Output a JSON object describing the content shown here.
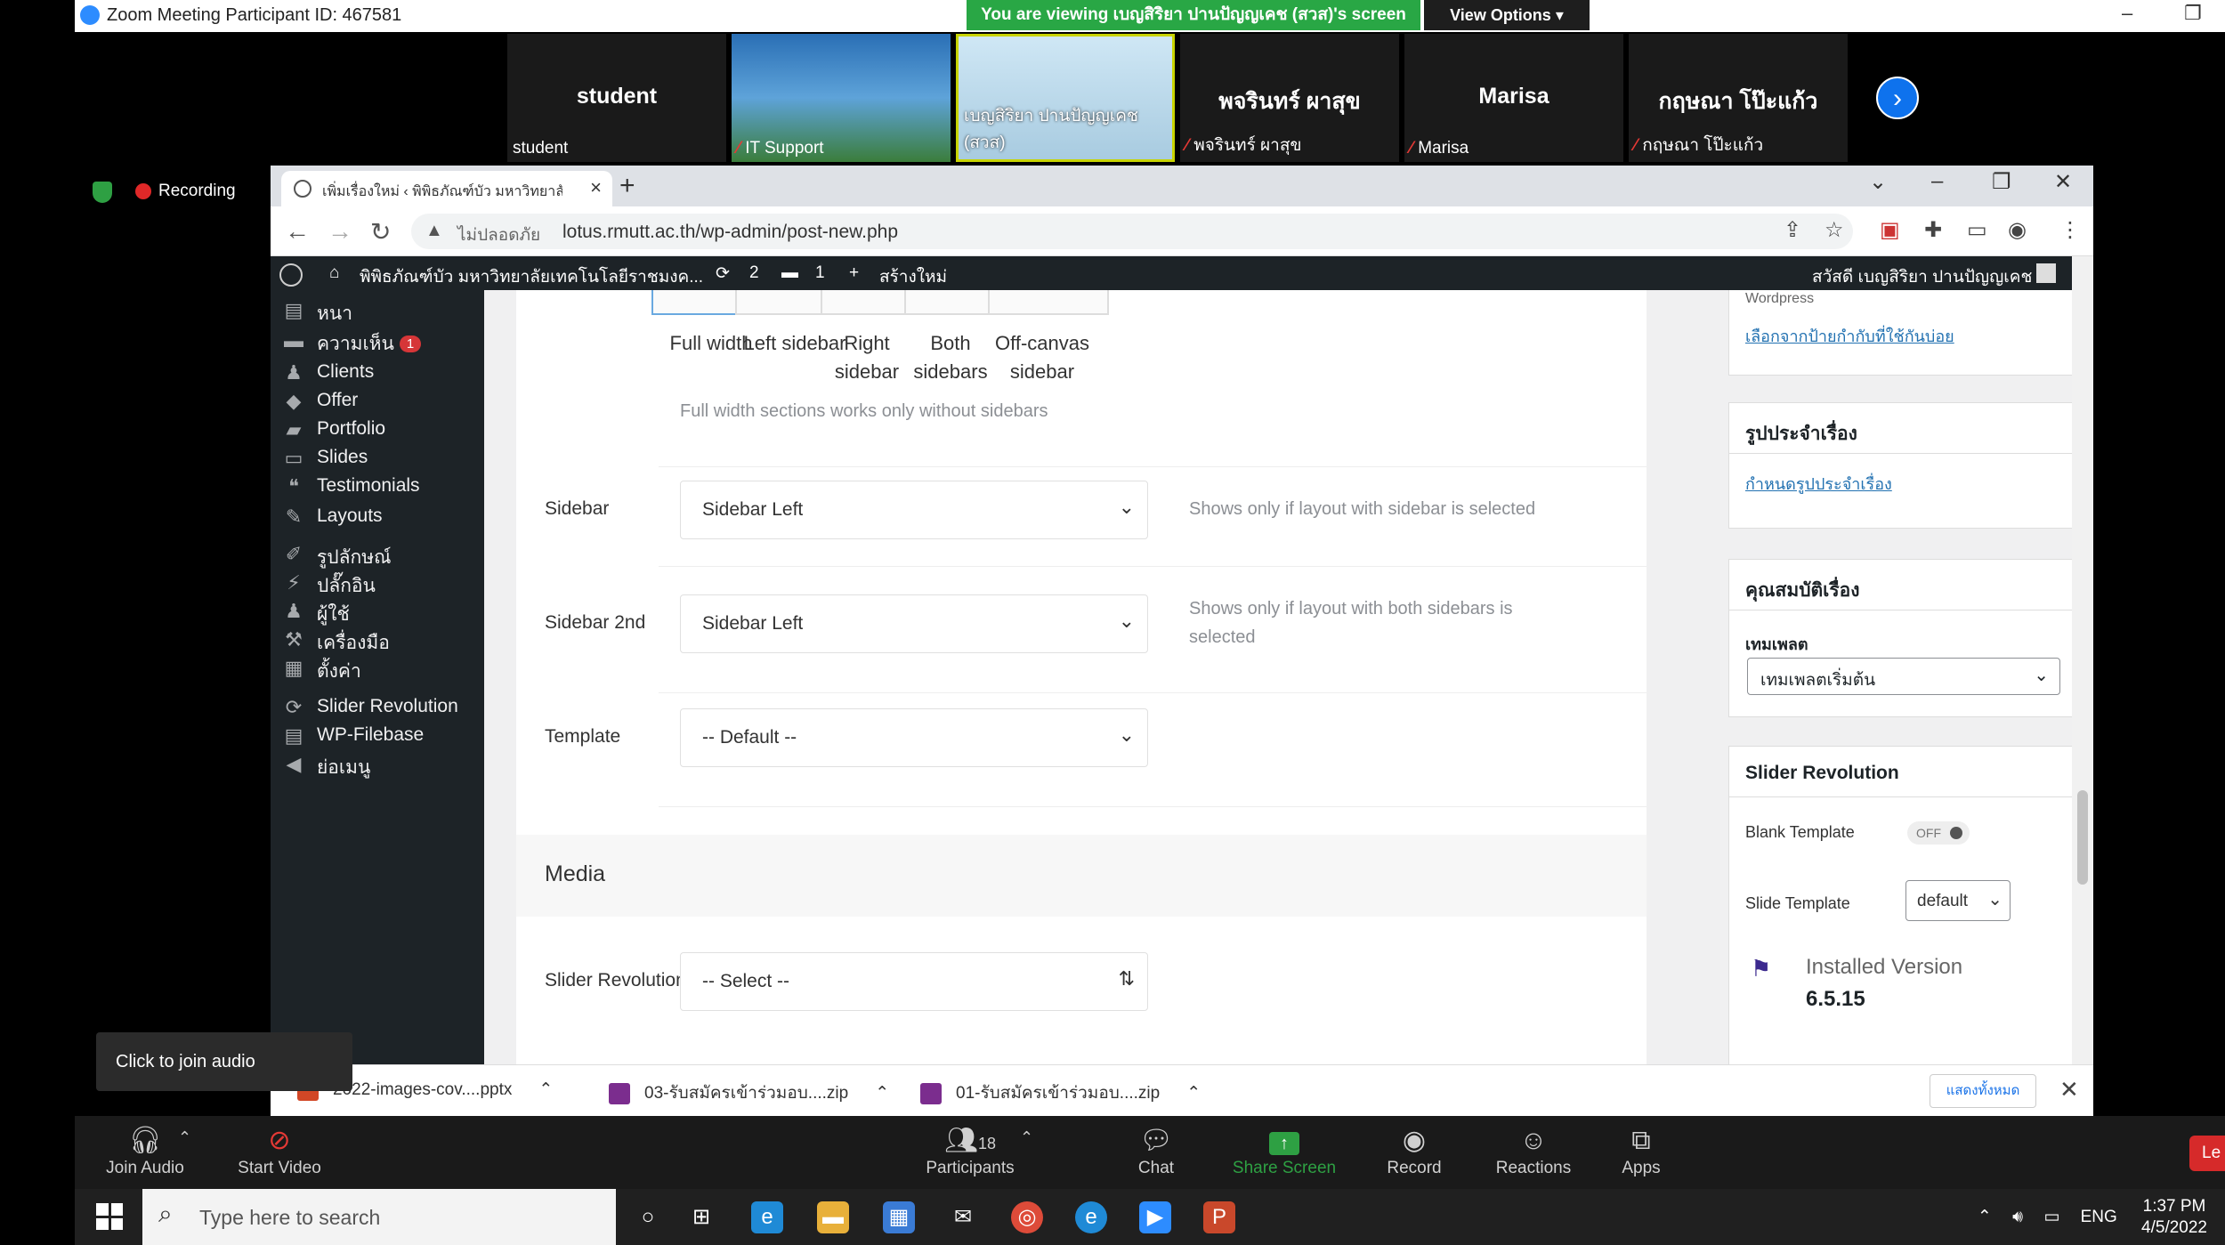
{
  "zoom": {
    "window_title": "Zoom Meeting Participant ID: 467581",
    "banner": "You are viewing เบญสิริยา ปานปัญญเคช (สวส)'s screen",
    "view_options": "View Options",
    "recording": "Recording",
    "join_audio_tooltip": "Click to join audio",
    "participants": [
      {
        "big_name": "student",
        "name": "student",
        "muted": false
      },
      {
        "big_name": "",
        "name": "IT Support",
        "muted": true
      },
      {
        "big_name": "",
        "name": "เบญสิริยา ปานปัญญเคช (สวส)",
        "muted": false
      },
      {
        "big_name": "พจรินทร์ ผาสุข",
        "name": "พจรินทร์ ผาสุข",
        "muted": true
      },
      {
        "big_name": "Marisa",
        "name": "Marisa",
        "muted": true
      },
      {
        "big_name": "กฤษณา โป๊ะแก้ว",
        "name": "กฤษณา โป๊ะแก้ว",
        "muted": true
      }
    ],
    "toolbar": {
      "join_audio": "Join Audio",
      "start_video": "Start Video",
      "participants": "Participants",
      "participants_count": "18",
      "chat": "Chat",
      "share_screen": "Share Screen",
      "record": "Record",
      "reactions": "Reactions",
      "apps": "Apps",
      "leave": "Le"
    }
  },
  "browser": {
    "tab_title": "เพิ่มเรื่องใหม่ ‹ พิพิธภัณฑ์บัว มหาวิทยาลัย",
    "security_label": "ไม่ปลอดภัย",
    "url": "lotus.rmutt.ac.th/wp-admin/post-new.php"
  },
  "wp": {
    "site_name": "พิพิธภัณฑ์บัว มหาวิทยาลัยเทคโนโลยีราชมงค...",
    "updates_count": "2",
    "comments_count": "1",
    "new_label": "สร้างใหม่",
    "greeting": "สวัสดี เบญสิริยา ปานปัญญเคช",
    "menu": [
      {
        "label": "หนา",
        "icon": "page-icon"
      },
      {
        "label": "ความเห็น",
        "icon": "comment-icon",
        "badge": "1"
      },
      {
        "label": "Clients",
        "icon": "clients-icon"
      },
      {
        "label": "Offer",
        "icon": "tag-icon"
      },
      {
        "label": "Portfolio",
        "icon": "folder-icon"
      },
      {
        "label": "Slides",
        "icon": "slides-icon"
      },
      {
        "label": "Testimonials",
        "icon": "quote-icon"
      },
      {
        "label": "Layouts",
        "icon": "pencil-icon"
      },
      {
        "label": "รูปลักษณ์",
        "icon": "brush-icon"
      },
      {
        "label": "ปลั๊กอิน",
        "icon": "plugin-icon"
      },
      {
        "label": "ผู้ใช้",
        "icon": "user-icon"
      },
      {
        "label": "เครื่องมือ",
        "icon": "wrench-icon"
      },
      {
        "label": "ตั้งค่า",
        "icon": "settings-icon"
      },
      {
        "label": "Slider Revolution",
        "icon": "refresh-icon"
      },
      {
        "label": "WP-Filebase",
        "icon": "file-icon"
      },
      {
        "label": "ย่อเมนู",
        "icon": "collapse-icon"
      }
    ],
    "layouts": [
      "Full width",
      "Left sidebar",
      "Right sidebar",
      "Both sidebars",
      "Off-canvas sidebar"
    ],
    "layout_note": "Full width sections works only without sidebars",
    "sidebar": {
      "label": "Sidebar",
      "value": "Sidebar Left",
      "note": "Shows only if layout with sidebar is selected"
    },
    "sidebar2": {
      "label": "Sidebar 2nd",
      "value": "Sidebar Left",
      "note_line1": "Shows only if layout with both sidebars is",
      "note_line2": "selected"
    },
    "template": {
      "label": "Template",
      "value": "-- Default --"
    },
    "media_title": "Media",
    "slider": {
      "label": "Slider Revolution",
      "value": "-- Select --"
    },
    "right": {
      "wordpress_tag_partial": "Wordpress",
      "tags_link": "เลือกจากป้ายกำกับที่ใช้กันบ่อย",
      "featured_title": "รูปประจำเรื่อง",
      "featured_link": "กำหนดรูปประจำเรื่อง",
      "attributes_title": "คุณสมบัติเรื่อง",
      "template_label": "เทมเพลต",
      "template_value": "เทมเพลตเริ่มต้น",
      "slider_title": "Slider Revolution",
      "blank_template_label": "Blank Template",
      "blank_template_state": "OFF",
      "slide_template_label": "Slide Template",
      "slide_template_value": "default",
      "installed_label": "Installed Version",
      "installed_version": "6.5.15"
    }
  },
  "downloads": [
    {
      "name": "2022-images-cov....pptx",
      "color": "#d24726"
    },
    {
      "name": "03-รับสมัครเข้าร่วมอบ....zip",
      "color": "#7b2d8e"
    },
    {
      "name": "01-รับสมัครเข้าร่วมอบ....zip",
      "color": "#7b2d8e"
    }
  ],
  "downloads_show_all": "แสดงทั้งหมด",
  "taskbar": {
    "search_placeholder": "Type here to search",
    "language": "ENG",
    "time": "1:37 PM",
    "date": "4/5/2022"
  }
}
